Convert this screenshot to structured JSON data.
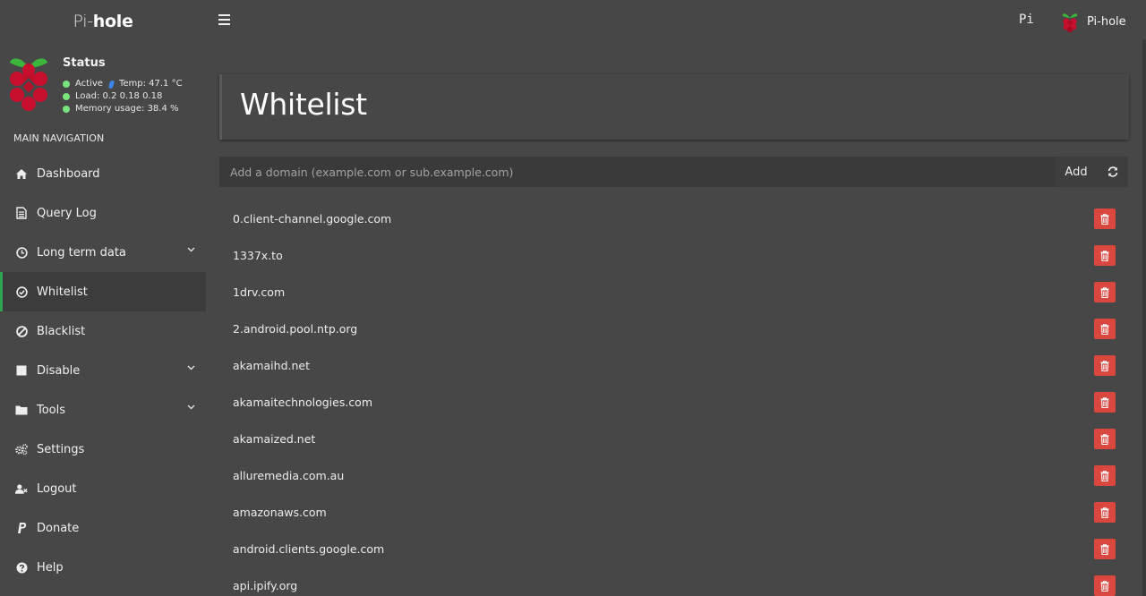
{
  "brand": {
    "part1": "Pi-",
    "part2": "hole"
  },
  "header": {
    "hostname": "Pi",
    "user_name": "Pi-hole"
  },
  "status": {
    "title": "Status",
    "active_label": "Active",
    "temp": "Temp: 47.1 °C",
    "load": "Load:  0.2  0.18  0.18",
    "memory": "Memory usage:  38.4 %"
  },
  "nav_header": "MAIN NAVIGATION",
  "nav": [
    {
      "label": "Dashboard",
      "icon": "home-icon"
    },
    {
      "label": "Query Log",
      "icon": "file-icon"
    },
    {
      "label": "Long term data",
      "icon": "clock-icon",
      "expand": true
    },
    {
      "label": "Whitelist",
      "icon": "check-circle-icon",
      "active": true
    },
    {
      "label": "Blacklist",
      "icon": "ban-icon"
    },
    {
      "label": "Disable",
      "icon": "stop-icon",
      "expand": true
    },
    {
      "label": "Tools",
      "icon": "folder-icon",
      "expand": true
    },
    {
      "label": "Settings",
      "icon": "gears-icon"
    },
    {
      "label": "Logout",
      "icon": "user-x-icon"
    },
    {
      "label": "Donate",
      "icon": "paypal-icon"
    },
    {
      "label": "Help",
      "icon": "question-icon"
    }
  ],
  "page": {
    "title": "Whitelist"
  },
  "add": {
    "placeholder": "Add a domain (example.com or sub.example.com)",
    "button": "Add"
  },
  "domains": [
    "0.client-channel.google.com",
    "1337x.to",
    "1drv.com",
    "2.android.pool.ntp.org",
    "akamaihd.net",
    "akamaitechnologies.com",
    "akamaized.net",
    "alluremedia.com.au",
    "amazonaws.com",
    "android.clients.google.com",
    "api.ipify.org"
  ],
  "colors": {
    "accent": "#2ea34f",
    "danger": "#d9473e",
    "background": "#474747"
  }
}
